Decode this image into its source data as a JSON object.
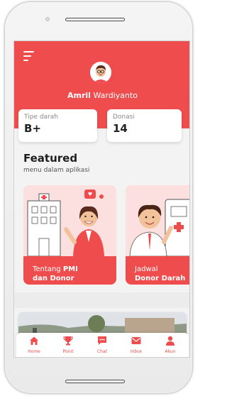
{
  "user": {
    "first_name": "Amril",
    "last_name": "Wardiyanto"
  },
  "stats": [
    {
      "label": "Tipe darah",
      "value": "B+"
    },
    {
      "label": "Donasi",
      "value": "14"
    }
  ],
  "featured": {
    "title": "Featured",
    "subtitle": "menu dalam aplikasi",
    "cards": [
      {
        "line1": "Tentang",
        "line1_bold": "PMI",
        "line2": "dan Donor"
      },
      {
        "line1": "Jadwal",
        "line2": "Donor Darah"
      }
    ]
  },
  "nav": {
    "items": [
      {
        "label": "Home",
        "icon": "home-icon"
      },
      {
        "label": "Point",
        "icon": "trophy-icon"
      },
      {
        "label": "Chat",
        "icon": "chat-icon"
      },
      {
        "label": "Inbox",
        "icon": "mail-icon"
      },
      {
        "label": "Akun",
        "icon": "user-icon"
      }
    ]
  },
  "colors": {
    "primary": "#ef4d4d",
    "background": "#f3f3f3",
    "card_tint": "#fbe0df"
  }
}
